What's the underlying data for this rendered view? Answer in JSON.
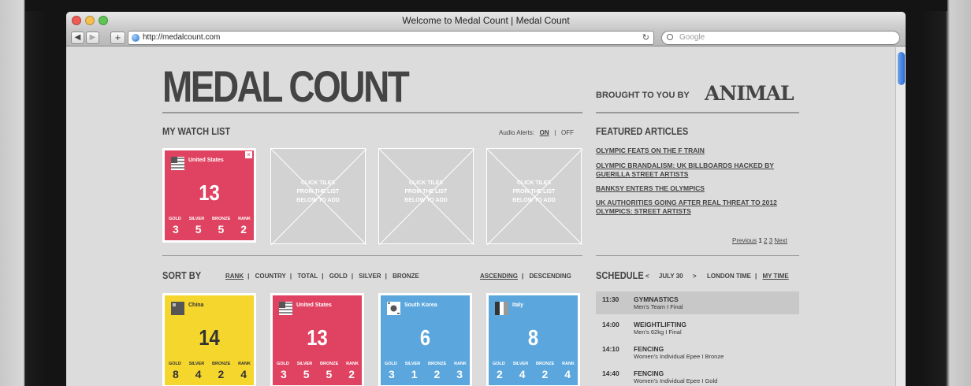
{
  "browser": {
    "title": "Welcome to Medal Count | Medal Count",
    "url": "http://medalcount.com",
    "search_placeholder": "Google"
  },
  "header": {
    "logo": "MEDAL COUNT",
    "brought_by": "BROUGHT TO YOU BY",
    "sponsor": "ANIMAL"
  },
  "watchlist": {
    "title": "MY WATCH LIST",
    "audio_label": "Audio Alerts:",
    "audio_on": "ON",
    "audio_off": "OFF",
    "tile": {
      "country": "United States",
      "total": "13",
      "gold": "3",
      "silver": "5",
      "bronze": "5",
      "rank": "2"
    },
    "empty_text": "CLICK TILES FROM THE LIST BELOW TO ADD",
    "labels": {
      "gold": "GOLD",
      "silver": "SILVER",
      "bronze": "BRONZE",
      "rank": "RANK"
    }
  },
  "featured": {
    "title": "FEATURED ARTICLES",
    "articles": [
      "OLYMPIC FEATS ON THE F TRAIN",
      "OLYMPIC BRANDALISM: UK BILLBOARDS HACKED BY GUERILLA STREET ARTISTS",
      "BANKSY ENTERS THE OLYMPICS",
      "UK AUTHORITIES GOING AFTER REAL THREAT TO 2012 OLYMPICS: STREET ARTISTS"
    ],
    "pager": {
      "prev": "Previous",
      "p1": "1",
      "p2": "2",
      "p3": "3",
      "next": "Next"
    }
  },
  "sort": {
    "title": "SORT BY",
    "options": [
      "RANK",
      "COUNTRY",
      "TOTAL",
      "GOLD",
      "SILVER",
      "BRONZE"
    ],
    "ascending": "ASCENDING",
    "descending": "DESCENDING"
  },
  "tiles": [
    {
      "country": "China",
      "total": "14",
      "gold": "8",
      "silver": "4",
      "bronze": "2",
      "rank": "4",
      "color": "#f5d62d"
    },
    {
      "country": "United States",
      "total": "13",
      "gold": "3",
      "silver": "5",
      "bronze": "5",
      "rank": "2",
      "color": "#e04361"
    },
    {
      "country": "South Korea",
      "total": "6",
      "gold": "3",
      "silver": "1",
      "bronze": "2",
      "rank": "3",
      "color": "#5ba6dc"
    },
    {
      "country": "Italy",
      "total": "8",
      "gold": "2",
      "silver": "4",
      "bronze": "2",
      "rank": "4",
      "color": "#5ba6dc"
    }
  ],
  "schedule": {
    "title": "SCHEDULE",
    "prev": "<",
    "date": "JULY 30",
    "next": ">",
    "london_time": "LONDON TIME",
    "my_time": "MY TIME",
    "events": [
      {
        "time": "11:30",
        "event": "GYMNASTICS",
        "detail": "Men's Team  I  Final"
      },
      {
        "time": "14:00",
        "event": "WEIGHTLIFTING",
        "detail": "Men's 62kg  I  Final"
      },
      {
        "time": "14:10",
        "event": "FENCING",
        "detail": "Women's Individual Epee  I  Bronze"
      },
      {
        "time": "14:40",
        "event": "FENCING",
        "detail": "Women's Individual Epee  I  Gold"
      }
    ]
  }
}
